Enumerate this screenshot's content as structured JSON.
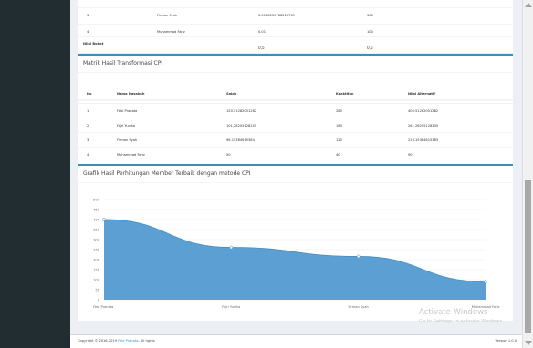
{
  "top_table": {
    "rows": [
      {
        "no": "3",
        "nama": "Firman Syah",
        "nilai": "0.0138239788220769",
        "bobot": "300"
      },
      {
        "no": "4",
        "nama": "Muhammad Fariz",
        "nilai": "0.01",
        "bobot": "100"
      }
    ],
    "footer": {
      "label": "Nilai Bobot",
      "col3": "0,5",
      "col4": "0,5"
    }
  },
  "matrix": {
    "title": "Matrik Hasil Transformasi CPI",
    "headers": [
      "No",
      "Nama Nasabah",
      "Saldo",
      "Keaktifan",
      "Nilai Alternatif"
    ],
    "rows": [
      [
        "1",
        "Febi Pranata",
        "120.51282051282",
        "280",
        "400.51282051282"
      ],
      [
        "2",
        "Fajri Yunika",
        "101.28205128205",
        "160",
        "261.28205128205"
      ],
      [
        "3",
        "Firman Syah",
        "96.15384615384",
        "120",
        "216.15384615385"
      ],
      [
        "4",
        "Muhammad Fariz",
        "50",
        "40",
        "90"
      ]
    ]
  },
  "chart": {
    "title": "Grafik Hasil Perhitungan Member Terbaik dengan metode CPI"
  },
  "chart_data": {
    "type": "area",
    "title": "Grafik Hasil Perhitungan Member Terbaik dengan metode CPI",
    "categories": [
      "Febi Pranata",
      "Fajri Yunika",
      "Firman Syah",
      "Muhammad Fariz"
    ],
    "values": [
      400.51,
      261.28,
      216.15,
      90
    ],
    "ylim": [
      0,
      500
    ],
    "yticks": [
      "0",
      "50",
      "100",
      "150",
      "200",
      "250",
      "300",
      "350",
      "400",
      "450",
      "500"
    ],
    "xlabel": "",
    "ylabel": "",
    "grid": true,
    "fill_color": "#5c9fd3",
    "point_color": "#ffffff"
  },
  "footer": {
    "copyright_prefix": "Copyright © 2016-2019",
    "brand": "Febi Pranata",
    "copyright_suffix": ". All rights",
    "version": "Version 1.0.0"
  },
  "watermark": {
    "line1": "Activate Windows",
    "line2": "Go to Settings to activate Windows."
  },
  "colors": {
    "sidebar": "#222d32",
    "accent": "#3c8dbc",
    "background": "#ecf0f5"
  }
}
